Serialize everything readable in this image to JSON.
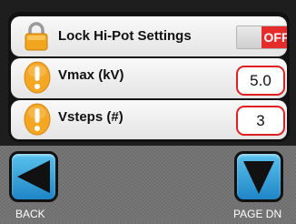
{
  "settings": {
    "lock": {
      "label": "Lock Hi-Pot Settings",
      "icon": "padlock-icon",
      "toggle_state": "OFF"
    },
    "vmax": {
      "label": "Vmax (kV)",
      "icon": "warning-icon",
      "value": "5.0"
    },
    "vsteps": {
      "label": "Vsteps (#)",
      "icon": "warning-icon",
      "value": "3"
    }
  },
  "navigation": {
    "back": {
      "label": "BACK",
      "icon": "arrow-left-icon"
    },
    "page_down": {
      "label": "PAGE DN",
      "icon": "arrow-down-icon"
    }
  },
  "colors": {
    "toggle_off": "#e62b2b",
    "field_border": "#e02020",
    "warning": "#f5a623",
    "nav_button": "#3aa6dd"
  }
}
